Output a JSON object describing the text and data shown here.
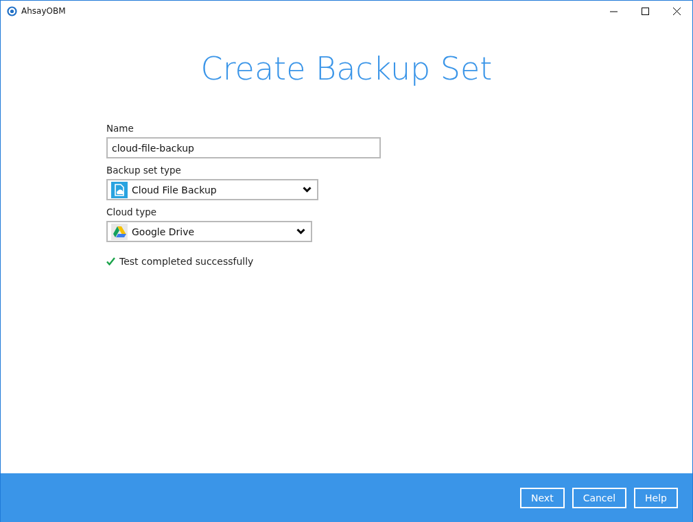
{
  "window": {
    "title": "AhsayOBM"
  },
  "heading": "Create Backup Set",
  "fields": [
    {
      "kind": "text",
      "label": "Name",
      "value": "cloud-file-backup"
    },
    {
      "kind": "select",
      "label": "Backup set type",
      "value": "Cloud File Backup"
    },
    {
      "kind": "select",
      "label": "Cloud type",
      "value": "Google Drive"
    }
  ],
  "status": {
    "kind": "success",
    "text": "Test completed successfully"
  },
  "buttons": [
    "Next",
    "Cancel",
    "Help"
  ]
}
